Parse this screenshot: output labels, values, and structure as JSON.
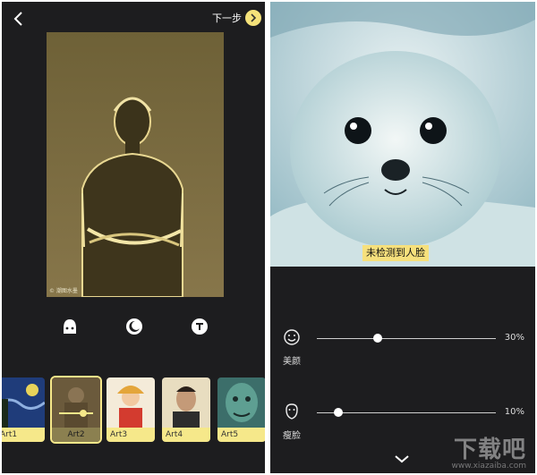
{
  "left": {
    "header": {
      "back_icon": "chevron-left-icon",
      "next_label": "下一步",
      "next_icon": "chevron-right-circle-icon"
    },
    "photo": {
      "watermark": "© 潮图水墨"
    },
    "tools": [
      {
        "icon": "face-mask-icon"
      },
      {
        "icon": "moon-icon"
      },
      {
        "icon": "text-t-icon"
      }
    ],
    "styles": [
      {
        "label": "Art1",
        "selected": false
      },
      {
        "label": "Art2",
        "selected": true
      },
      {
        "label": "Art3",
        "selected": false
      },
      {
        "label": "Art4",
        "selected": false
      },
      {
        "label": "Art5",
        "selected": false
      }
    ]
  },
  "right": {
    "notice": "未检测到人脸",
    "sliders": [
      {
        "label": "美颜",
        "icon": "smile-face-icon",
        "value": 30,
        "value_text": "30%"
      },
      {
        "label": "瘦脸",
        "icon": "slim-face-icon",
        "value": 10,
        "value_text": "10%"
      }
    ],
    "collapse_icon": "chevron-down-icon",
    "watermark": {
      "brand": "下载吧",
      "url": "www.xiazaiba.com"
    }
  },
  "colors": {
    "accent": "#f6e88a",
    "background": "#1d1d1f"
  }
}
